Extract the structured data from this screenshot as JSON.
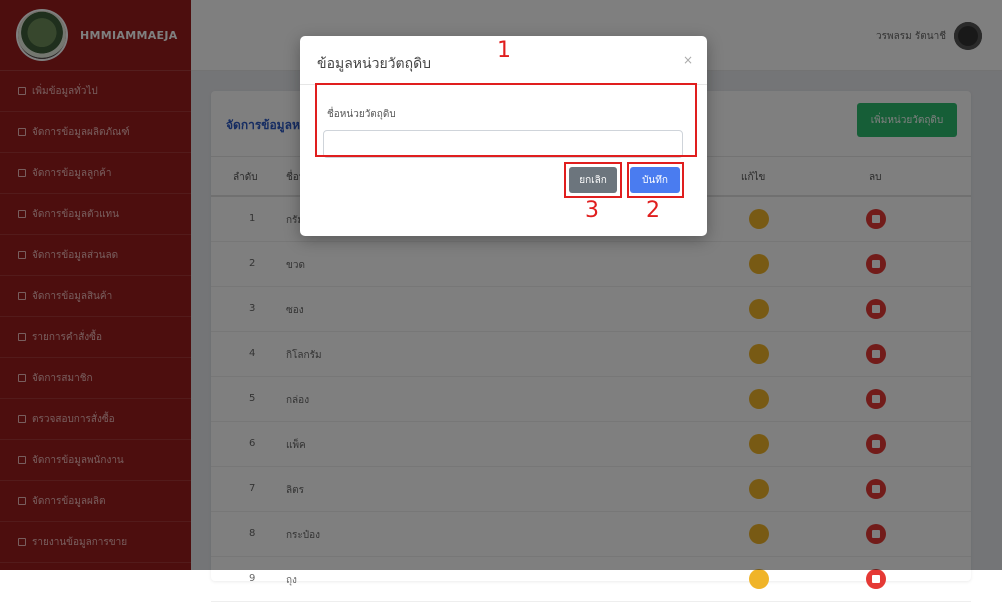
{
  "sidebar": {
    "brand": "HMMIAMMAEJA",
    "items": [
      {
        "label": "เพิ่มข้อมูลทั่วไป"
      },
      {
        "label": "จัดการข้อมูลผลิตภัณฑ์"
      },
      {
        "label": "จัดการข้อมูลลูกค้า"
      },
      {
        "label": "จัดการข้อมูลตัวแทน"
      },
      {
        "label": "จัดการข้อมูลส่วนลด"
      },
      {
        "label": "จัดการข้อมูลสินค้า"
      },
      {
        "label": "รายการคำสั่งซื้อ"
      },
      {
        "label": "จัดการสมาชิก"
      },
      {
        "label": "ตรวจสอบการสั่งซื้อ"
      },
      {
        "label": "จัดการข้อมูลพนักงาน"
      },
      {
        "label": "จัดการข้อมูลผลิต"
      },
      {
        "label": "รายงานข้อมูลการขาย"
      }
    ]
  },
  "header": {
    "user_name": "วรพลรม รัตนาชี"
  },
  "card": {
    "title": "จัดการข้อมูลหน่วยวัตถุดิบ",
    "add_button": "เพิ่มหน่วยวัตถุดิบ",
    "columns": {
      "no": "ลำดับ",
      "name": "ชื่อหน่วย",
      "edit": "แก้ไข",
      "delete": "ลบ"
    },
    "rows": [
      {
        "no": "1",
        "name": "กรัม"
      },
      {
        "no": "2",
        "name": "ขวด"
      },
      {
        "no": "3",
        "name": "ซอง"
      },
      {
        "no": "4",
        "name": "กิโลกรัม"
      },
      {
        "no": "5",
        "name": "กล่อง"
      },
      {
        "no": "6",
        "name": "แพ็ค"
      },
      {
        "no": "7",
        "name": "ลิตร"
      },
      {
        "no": "8",
        "name": "กระป๋อง"
      },
      {
        "no": "9",
        "name": "ถุง"
      }
    ]
  },
  "modal": {
    "title": "ข้อมูลหน่วยวัตถุดิบ",
    "close": "×",
    "field_label": "ชื่อหน่วยวัตถุดิบ",
    "field_value": "",
    "cancel_button": "ยกเลิก",
    "save_button": "บันทึก"
  },
  "annotations": {
    "n1": "1",
    "n2": "2",
    "n3": "3"
  },
  "colors": {
    "sidebar": "#9b1c1c",
    "accent": "#2b58c4",
    "add_button": "#2dbd6e",
    "save_button": "#4a7cf0",
    "cancel_button": "#6c757d",
    "annotation": "#e01e1e"
  }
}
